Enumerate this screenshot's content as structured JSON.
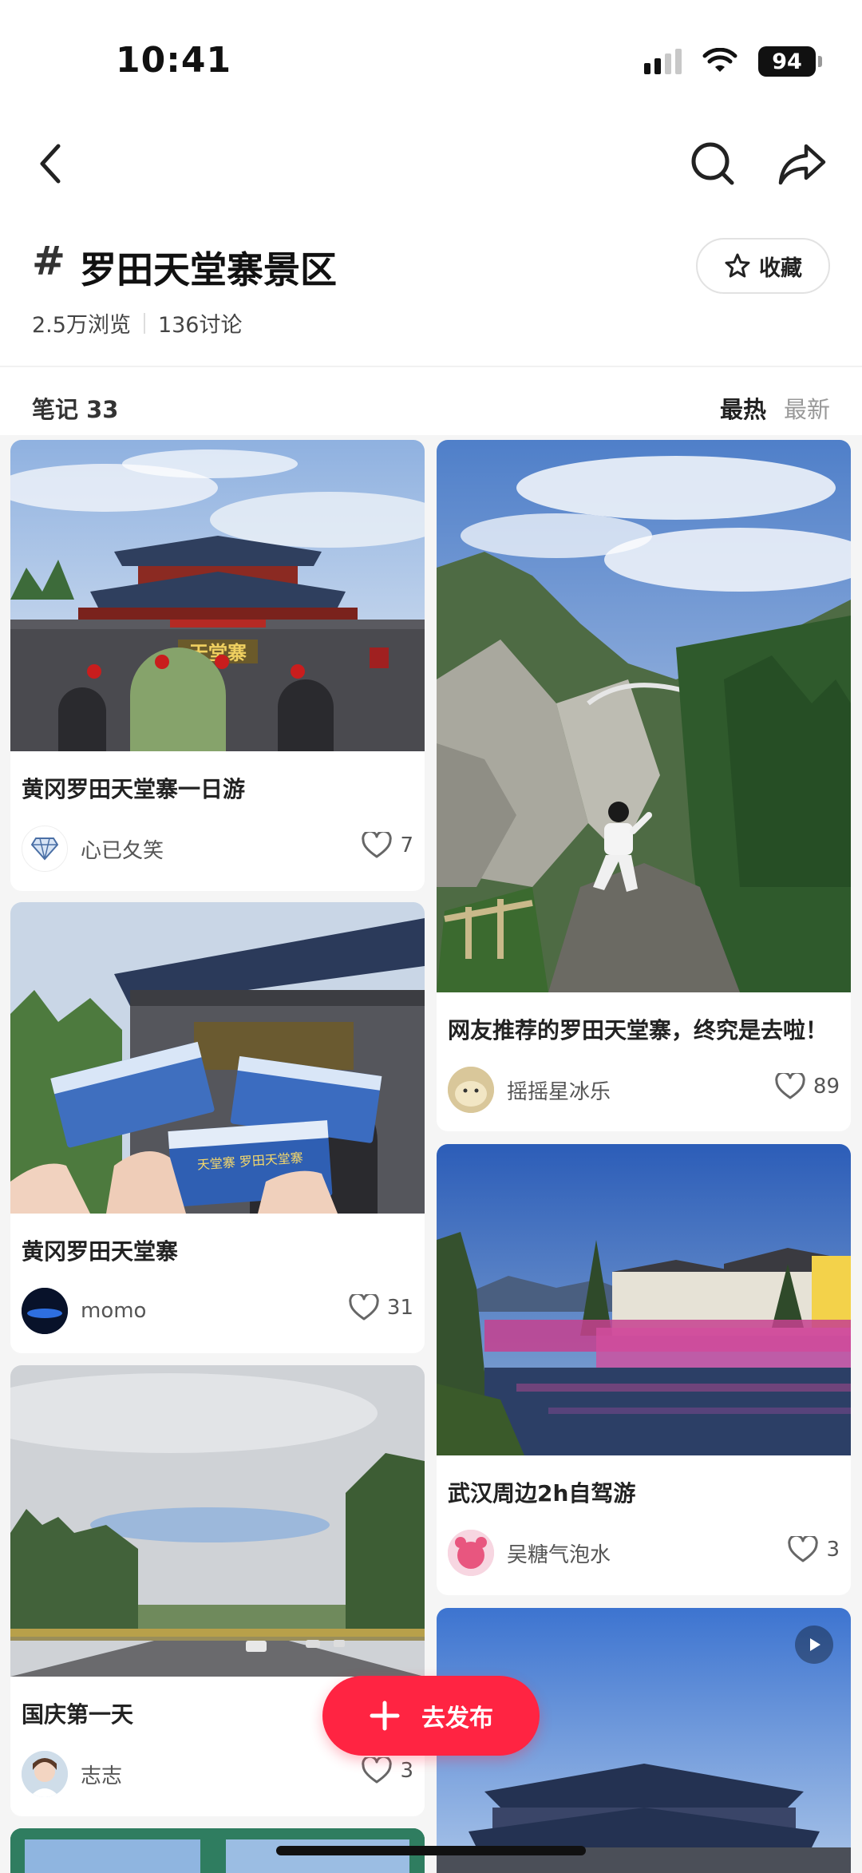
{
  "status_bar": {
    "time": "10:41",
    "battery": "94"
  },
  "topic": {
    "hash": "#",
    "title": "罗田天堂寨景区",
    "views": "2.5万浏览",
    "discussions": "136讨论",
    "collect_label": "收藏"
  },
  "list": {
    "notes_label": "笔记 33",
    "sort_hot": "最热",
    "sort_new": "最新"
  },
  "cards": [
    {
      "title": "黄冈罗田天堂寨一日游",
      "author": "心已夂笑",
      "likes": "7"
    },
    {
      "title": "网友推荐的罗田天堂寨，终究是去啦！",
      "author": "摇摇星冰乐",
      "likes": "89"
    },
    {
      "title": "黄冈罗田天堂寨",
      "author": "momo",
      "likes": "31"
    },
    {
      "title": "武汉周边2h自驾游",
      "author": "吴糖气泡水",
      "likes": "3"
    },
    {
      "title": "国庆第一天",
      "author": "志志",
      "likes": "3"
    }
  ],
  "photo_texts": {
    "gate_sign": "天堂寨",
    "ticket_text": "天堂寨 罗田天堂寨"
  },
  "fab": {
    "label": "去发布"
  },
  "colors": {
    "accent": "#ff2442",
    "feed_bg": "#f5f5f5"
  }
}
